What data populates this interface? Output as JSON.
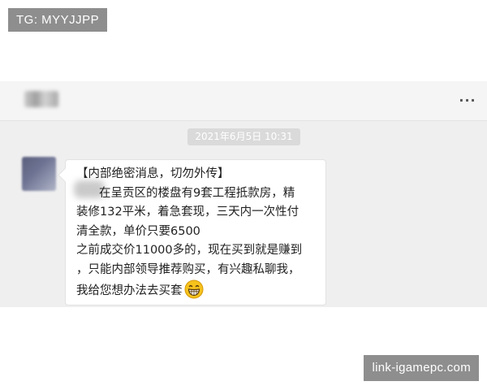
{
  "watermarks": {
    "top": "TG: MYYJJPP",
    "bottom": "link-igamepc.com"
  },
  "header": {
    "more_label": "..."
  },
  "chat": {
    "timestamp": "2021年6月5日 10:31",
    "message": {
      "lines": [
        "【内部绝密消息，切勿外传】",
        "在呈贡区的楼盘有9套工程抵款房，精",
        "装修132平米，着急套现，三天内一次性付",
        "清全款，单价只要6500",
        "之前成交价11000多的，现在买到就是赚到",
        "，只能内部领导推荐购买，有兴趣私聊我，",
        "我给您想办法去买套"
      ],
      "emoji": "grinning-face-icon"
    }
  },
  "colors": {
    "chat_background": "#efefef",
    "bubble_background": "#ffffff",
    "timestamp_badge": "#dadada",
    "watermark_background": "#8e8e8e",
    "emoji_face": "#f6c21c"
  }
}
